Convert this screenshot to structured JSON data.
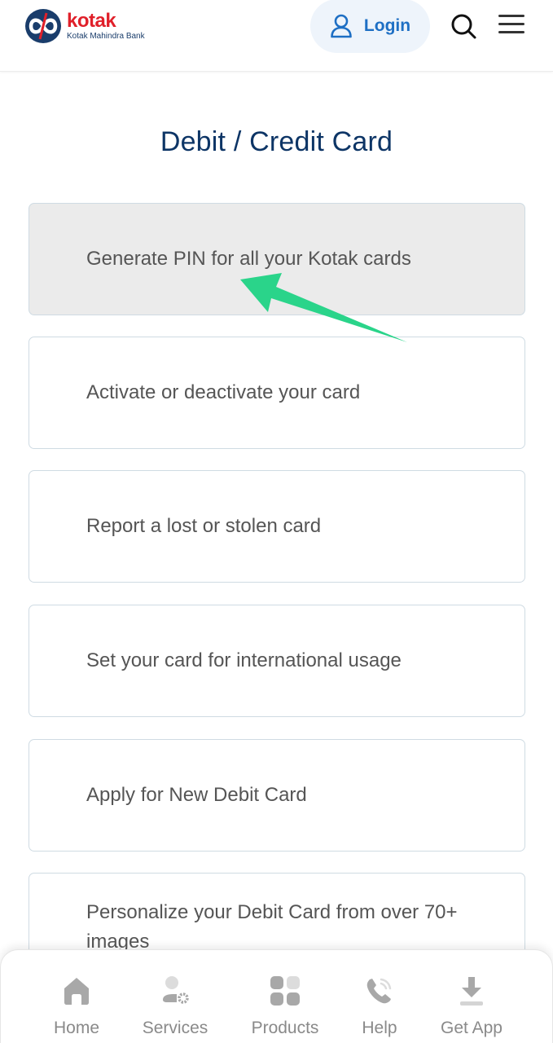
{
  "header": {
    "logo": {
      "word": "kotak",
      "subtitle": "Kotak Mahindra Bank",
      "icon": "kotak-infinity-logo"
    },
    "login": {
      "label": "Login",
      "icon": "user-icon"
    },
    "search": {
      "icon": "search-icon"
    },
    "menu": {
      "icon": "hamburger-menu-icon"
    }
  },
  "page": {
    "title": "Debit / Credit Card"
  },
  "cards": [
    {
      "label": "Generate PIN for all your Kotak cards",
      "highlighted": true
    },
    {
      "label": "Activate or deactivate your card",
      "highlighted": false
    },
    {
      "label": "Report a lost or stolen card",
      "highlighted": false
    },
    {
      "label": "Set your card for international usage",
      "highlighted": false
    },
    {
      "label": "Apply for New Debit Card",
      "highlighted": false
    },
    {
      "label": "Personalize your Debit Card from over 70+ images",
      "highlighted": false
    }
  ],
  "annotation": {
    "type": "arrow",
    "color": "#2ad48a",
    "points_to": "Generate PIN for all your Kotak cards"
  },
  "bottom_nav": {
    "items": [
      {
        "label": "Home",
        "icon": "home-icon"
      },
      {
        "label": "Services",
        "icon": "user-settings-icon"
      },
      {
        "label": "Products",
        "icon": "grid-icon"
      },
      {
        "label": "Help",
        "icon": "phone-call-icon"
      },
      {
        "label": "Get App",
        "icon": "download-icon"
      }
    ]
  },
  "colors": {
    "brand_red": "#e0202a",
    "brand_navy": "#1a3d6b",
    "title_navy": "#0d3566",
    "login_blue": "#1e6fc4",
    "login_bg": "#eef4fb",
    "card_border": "#cfdbe3",
    "card_active_bg": "#ebebeb",
    "nav_gray": "#8a8a8a"
  }
}
